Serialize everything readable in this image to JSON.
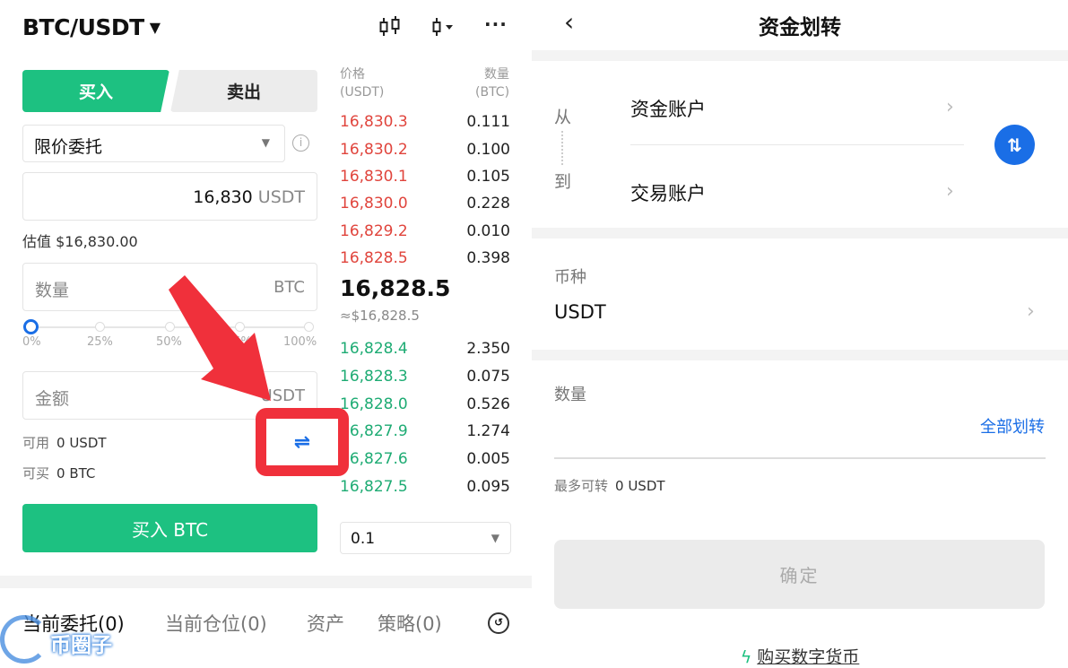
{
  "left": {
    "pair": "BTC/USDT",
    "side_tabs": {
      "buy": "买入",
      "sell": "卖出"
    },
    "order_type": "限价委托",
    "price": {
      "value": "16,830",
      "unit": "USDT"
    },
    "estimate": "估值 $16,830.00",
    "quantity": {
      "placeholder": "数量",
      "unit": "BTC"
    },
    "slider_ticks": [
      "0%",
      "25%",
      "50%",
      "75%",
      "100%"
    ],
    "slider_level": 0,
    "amount": {
      "placeholder": "金额",
      "unit": "USDT"
    },
    "available": {
      "label": "可用",
      "value": "0 USDT"
    },
    "can_buy": {
      "label": "可买",
      "value": "0 BTC"
    },
    "transfer_icon": "⇌",
    "buy_button": "买入 BTC",
    "orderbook": {
      "price_header": [
        "价格",
        "(USDT)"
      ],
      "qty_header": [
        "数量",
        "(BTC)"
      ],
      "asks": [
        {
          "price": "16,830.3",
          "qty": "0.111"
        },
        {
          "price": "16,830.2",
          "qty": "0.100"
        },
        {
          "price": "16,830.1",
          "qty": "0.105"
        },
        {
          "price": "16,830.0",
          "qty": "0.228"
        },
        {
          "price": "16,829.2",
          "qty": "0.010"
        },
        {
          "price": "16,828.5",
          "qty": "0.398"
        }
      ],
      "last_price": "16,828.5",
      "last_price_usd": "≈$16,828.5",
      "bids": [
        {
          "price": "16,828.4",
          "qty": "2.350"
        },
        {
          "price": "16,828.3",
          "qty": "0.075"
        },
        {
          "price": "16,828.0",
          "qty": "0.526"
        },
        {
          "price": "16,827.9",
          "qty": "1.274"
        },
        {
          "price": "16,827.6",
          "qty": "0.005"
        },
        {
          "price": "16,827.5",
          "qty": "0.095"
        }
      ],
      "depth": "0.1"
    },
    "bottom_tabs": [
      "当前委托(0)",
      "当前仓位(0)",
      "资产",
      "策略(0)"
    ],
    "watermark": "币圈子"
  },
  "right": {
    "title": "资金划转",
    "from_label": "从",
    "to_label": "到",
    "from_account": "资金账户",
    "to_account": "交易账户",
    "coin_label": "币种",
    "coin": "USDT",
    "qty_label": "数量",
    "all_transfer": "全部划转",
    "max_transfer": {
      "label": "最多可转",
      "value": "0 USDT"
    },
    "confirm": "确定",
    "buy_crypto": "购买数字货币"
  },
  "colors": {
    "green": "#1dc181",
    "red": "#e0443c",
    "blue": "#1a6ee6",
    "highlight": "#f0303b"
  }
}
